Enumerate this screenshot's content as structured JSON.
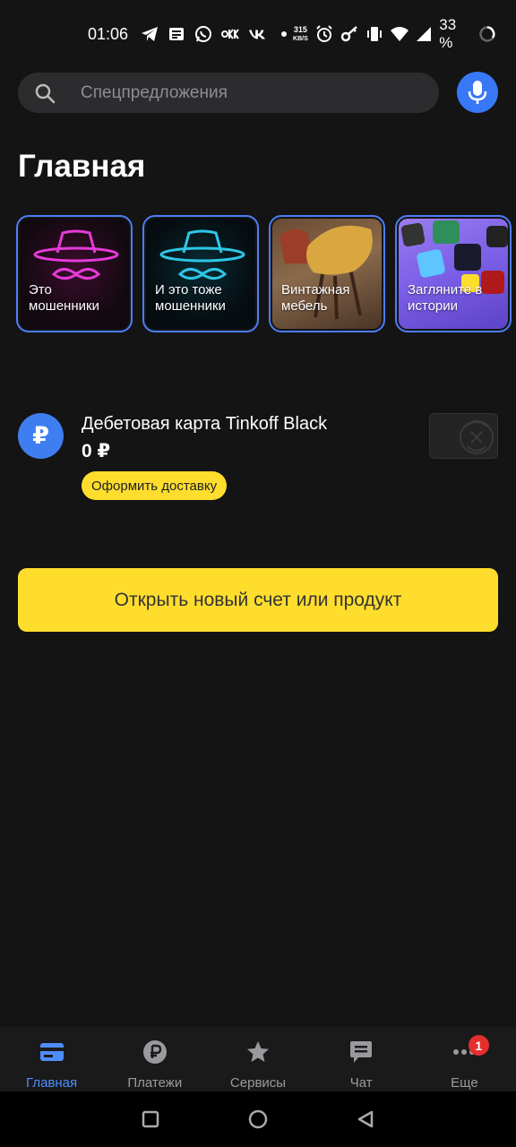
{
  "status_bar": {
    "time": "01:06",
    "net_speed_value": "315",
    "net_speed_unit": "KB/S",
    "battery_percent": "33 %"
  },
  "search": {
    "placeholder": "Спецпредложения"
  },
  "page_title": "Главная",
  "stories": [
    {
      "label": "Это мошенники"
    },
    {
      "label": "И это тоже мошенники"
    },
    {
      "label": "Винтажная мебель"
    },
    {
      "label": "Загляните в истории"
    }
  ],
  "account": {
    "icon_symbol": "₽",
    "name": "Дебетовая карта Tinkoff Black",
    "balance": "0 ₽",
    "delivery_button": "Оформить доставку"
  },
  "open_product_button": "Открыть новый счет или продукт",
  "bottom_nav": {
    "items": [
      {
        "label": "Главная",
        "icon": "card-icon",
        "active": true
      },
      {
        "label": "Платежи",
        "icon": "ruble-icon",
        "active": false
      },
      {
        "label": "Сервисы",
        "icon": "star-icon",
        "active": false
      },
      {
        "label": "Чат",
        "icon": "chat-icon",
        "active": false
      },
      {
        "label": "Еще",
        "icon": "more-icon",
        "active": false,
        "badge": "1"
      }
    ]
  },
  "colors": {
    "background": "#141414",
    "accent_blue": "#3877f5",
    "accent_yellow": "#ffdd2d",
    "badge_red": "#e52e2e"
  }
}
